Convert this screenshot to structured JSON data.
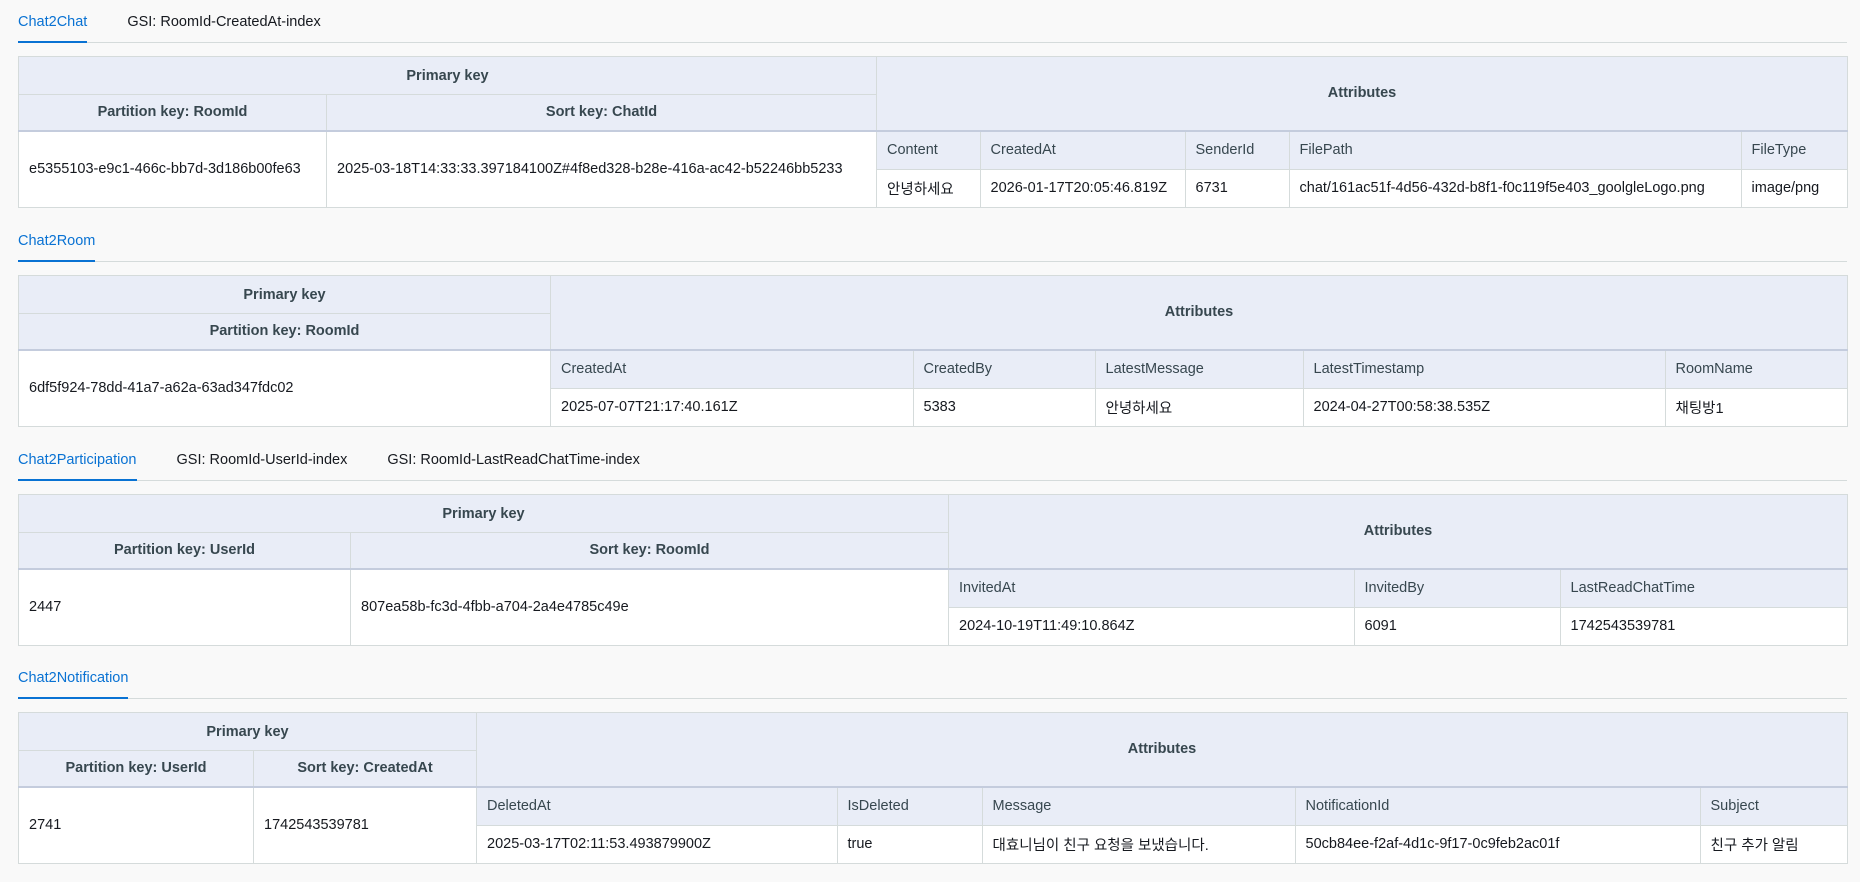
{
  "chat2chat": {
    "tabs": [
      "Chat2Chat",
      "GSI: RoomId-CreatedAt-index"
    ],
    "primary_key": "Primary key",
    "attributes": "Attributes",
    "partition_key": "Partition key: RoomId",
    "sort_key": "Sort key: ChatId",
    "partition_value": "e5355103-e9c1-466c-bb7d-3d186b00fe63",
    "sort_value": "2025-03-18T14:33:33.397184100Z#4f8ed328-b28e-416a-ac42-b52246bb5233",
    "attr_headers": [
      "Content",
      "CreatedAt",
      "SenderId",
      "FilePath",
      "FileType"
    ],
    "attr_values": [
      "안녕하세요",
      "2026-01-17T20:05:46.819Z",
      "6731",
      "chat/161ac51f-4d56-432d-b8f1-f0c119f5e403_goolgleLogo.png",
      "image/png"
    ]
  },
  "chat2room": {
    "tabs": [
      "Chat2Room"
    ],
    "primary_key": "Primary key",
    "attributes": "Attributes",
    "partition_key": "Partition key: RoomId",
    "partition_value": "6df5f924-78dd-41a7-a62a-63ad347fdc02",
    "attr_headers": [
      "CreatedAt",
      "CreatedBy",
      "LatestMessage",
      "LatestTimestamp",
      "RoomName"
    ],
    "attr_values": [
      "2025-07-07T21:17:40.161Z",
      "5383",
      "안녕하세요",
      "2024-04-27T00:58:38.535Z",
      "채팅방1"
    ]
  },
  "chat2participation": {
    "tabs": [
      "Chat2Participation",
      "GSI: RoomId-UserId-index",
      "GSI: RoomId-LastReadChatTime-index"
    ],
    "primary_key": "Primary key",
    "attributes": "Attributes",
    "partition_key": "Partition key: UserId",
    "sort_key": "Sort key: RoomId",
    "partition_value": "2447",
    "sort_value": "807ea58b-fc3d-4fbb-a704-2a4e4785c49e",
    "attr_headers": [
      "InvitedAt",
      "InvitedBy",
      "LastReadChatTime"
    ],
    "attr_values": [
      "2024-10-19T11:49:10.864Z",
      "6091",
      "1742543539781"
    ]
  },
  "chat2notification": {
    "tabs": [
      "Chat2Notification"
    ],
    "primary_key": "Primary key",
    "attributes": "Attributes",
    "partition_key": "Partition key: UserId",
    "sort_key": "Sort key: CreatedAt",
    "partition_value": "2741",
    "sort_value": "1742543539781",
    "attr_headers": [
      "DeletedAt",
      "IsDeleted",
      "Message",
      "NotificationId",
      "Subject"
    ],
    "attr_values": [
      "2025-03-17T02:11:53.493879900Z",
      "true",
      "대효니님이 친구 요청을 보냈습니다.",
      "50cb84ee-f2af-4d1c-9f17-0c9feb2ac01f",
      "친구 추가 알림"
    ]
  },
  "colors": {
    "accent": "#0972d3",
    "header_bg": "#e9edf7",
    "border": "#d5dbdb",
    "page_bg": "#f9f9f9"
  }
}
